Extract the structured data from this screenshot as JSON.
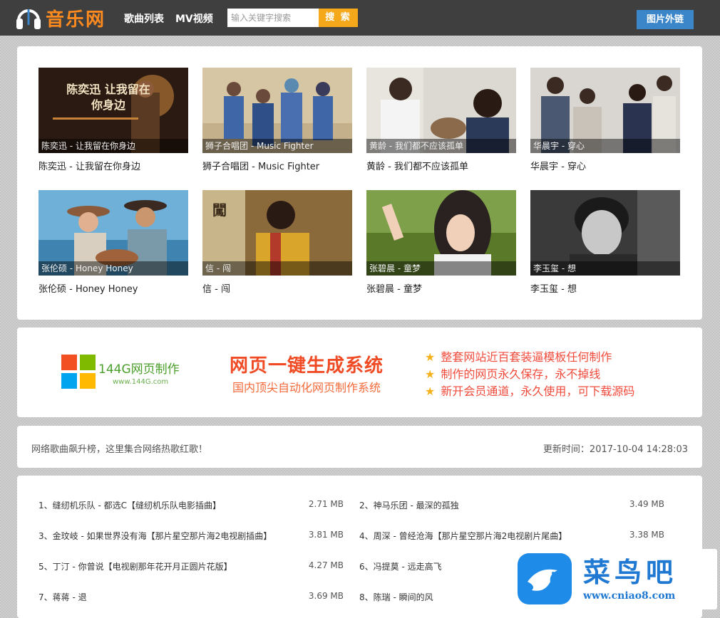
{
  "header": {
    "logo_text": "音乐网",
    "nav": [
      "歌曲列表",
      "MV视频"
    ],
    "search_placeholder": "输入关键字搜索",
    "search_button": "搜 索",
    "external_button": "图片外链"
  },
  "videos": [
    {
      "caption": "陈奕迅 - 让我留在你身边",
      "title": "陈奕迅 - 让我留在你身边",
      "poster_text": "陈奕迅 让我留在你身边",
      "palette": [
        "#3a2418",
        "#c7823a"
      ]
    },
    {
      "caption": "狮子合唱团 - Music Fighter",
      "title": "狮子合唱团 - Music Fighter",
      "palette": [
        "#d7c6a3",
        "#3f67a8"
      ]
    },
    {
      "caption": "黄龄 - 我们都不应该孤单",
      "title": "黄龄 - 我们都不应该孤单",
      "palette": [
        "#dcd8d2",
        "#2c3a5a"
      ]
    },
    {
      "caption": "华晨宇 - 穿心",
      "title": "华晨宇 - 穿心",
      "palette": [
        "#d9d6d2",
        "#4a5872"
      ]
    },
    {
      "caption": "张伦硕 - Honey Honey",
      "title": "张伦硕 - Honey Honey",
      "palette": [
        "#6fb0d8",
        "#8a5a3a"
      ]
    },
    {
      "caption": "信 - 闯",
      "title": "信 - 闯",
      "poster_text": "闖",
      "palette": [
        "#8a6a3a",
        "#d9a52a"
      ]
    },
    {
      "caption": "张碧晨 - 童梦",
      "title": "张碧晨 - 童梦",
      "palette": [
        "#7fa04a",
        "#2a2220"
      ]
    },
    {
      "caption": "李玉玺 - 想",
      "title": "李玉玺 - 想",
      "palette": [
        "#3a3a3a",
        "#c8c8c8"
      ]
    }
  ],
  "banner": {
    "brand_name": "144G网页制作",
    "brand_url": "www.144G.com",
    "title": "网页一键生成系统",
    "subtitle": "国内顶尖自动化网页制作系统",
    "features": [
      "整套网站近百套装逼模板任何制作",
      "制作的网页永久保存，永不掉线",
      "新开会员通道，永久使用，可下载源码"
    ],
    "colors": {
      "red": "#f25022",
      "green": "#7fba00",
      "blue": "#00a4ef",
      "yellow": "#ffb900"
    }
  },
  "info": {
    "description": "网络歌曲飙升榜，这里集合网络热歌红歌！",
    "updated": "更新时间：2017-10-04 14:28:03"
  },
  "songs": [
    {
      "title": "1、缝纫机乐队 - 都选C【缝纫机乐队电影插曲】",
      "size": "2.71 MB"
    },
    {
      "title": "2、神马乐团 - 最深的孤独",
      "size": "3.49 MB"
    },
    {
      "title": "3、金玟岐 - 如果世界没有海【那片星空那片海2电视剧插曲】",
      "size": "3.81 MB"
    },
    {
      "title": "4、周深 - 曾经沧海【那片星空那片海2电视剧片尾曲】",
      "size": "3.38 MB"
    },
    {
      "title": "5、丁汀 - 你曾说【电视剧那年花开月正圆片花版】",
      "size": "4.27 MB"
    },
    {
      "title": "6、冯提莫 - 远走高飞",
      "size": ""
    },
    {
      "title": "7、蒋蒋 - 退",
      "size": "3.69 MB"
    },
    {
      "title": "8、陈瑞 - 瞬间的风",
      "size": ""
    }
  ],
  "watermark": {
    "text": "菜鸟吧",
    "url": "www.cniao8.com"
  },
  "accent_colors": {
    "header_bg": "#3f3f3f",
    "logo": "#ff8a1e",
    "search_button": "#f5a81a",
    "external_button": "#3a86c8"
  }
}
